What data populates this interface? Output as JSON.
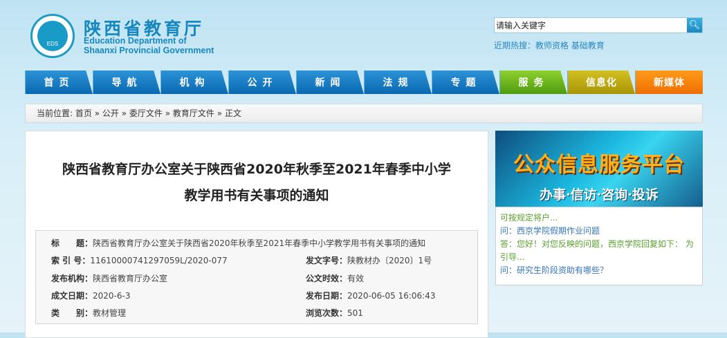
{
  "header": {
    "site_name": "陕西省教育厅",
    "site_en_1": "Education Department of",
    "site_en_2": "Shaanxi Provincial Government",
    "logo_text": "EDS",
    "search_placeholder": "请输入关键字",
    "hot_label": "近期热搜：",
    "hot_links": [
      "教师资格",
      "基础教育"
    ]
  },
  "nav": [
    "首页",
    "导航",
    "机构",
    "公开",
    "新闻",
    "法规",
    "专题",
    "服务",
    "信息化",
    "新媒体"
  ],
  "breadcrumb": {
    "label": "当前位置:",
    "items": [
      "首页",
      "公开",
      "委厅文件",
      "教育厅文件",
      "正文"
    ],
    "sep": "»"
  },
  "article": {
    "title_1": "陕西省教育厅办公室关于陕西省2020年秋季至2021年春季中小学",
    "title_2": "教学用书有关事项的通知"
  },
  "meta": {
    "title_label": "标　　题：",
    "title": "陕西省教育厅办公室关于陕西省2020年秋季至2021年春季中小学教学用书有关事项的通知",
    "index_label": "索 引 号：",
    "index": "11610000741297059L/2020-077",
    "docno_label": "发文字号：",
    "docno": "陕教材办〔2020〕1号",
    "org_label": "发布机构：",
    "org": "陕西省教育厅办公室",
    "valid_label": "公文时效：",
    "valid": "有效",
    "date_label": "成文日期：",
    "date": "2020-6-3",
    "pub_label": "发布日期：",
    "pub": "2020-06-05 16:06:43",
    "cat_label": "类　　别：",
    "cat": "教材管理",
    "views_label": "浏览次数：",
    "views": "501"
  },
  "banner": {
    "title": "公众信息服务平台",
    "subtitle": "办事·信访·咨询·投诉"
  },
  "qa": [
    {
      "t": "a",
      "text": "可按规定将户..."
    },
    {
      "t": "q",
      "text": "问：西京学院假期作业问题"
    },
    {
      "t": "a",
      "text": "答：您好！对您反映的问题，西京学院回复如下： 为引导..."
    },
    {
      "t": "q",
      "text": "问：研究生阶段资助有哪些？"
    }
  ]
}
